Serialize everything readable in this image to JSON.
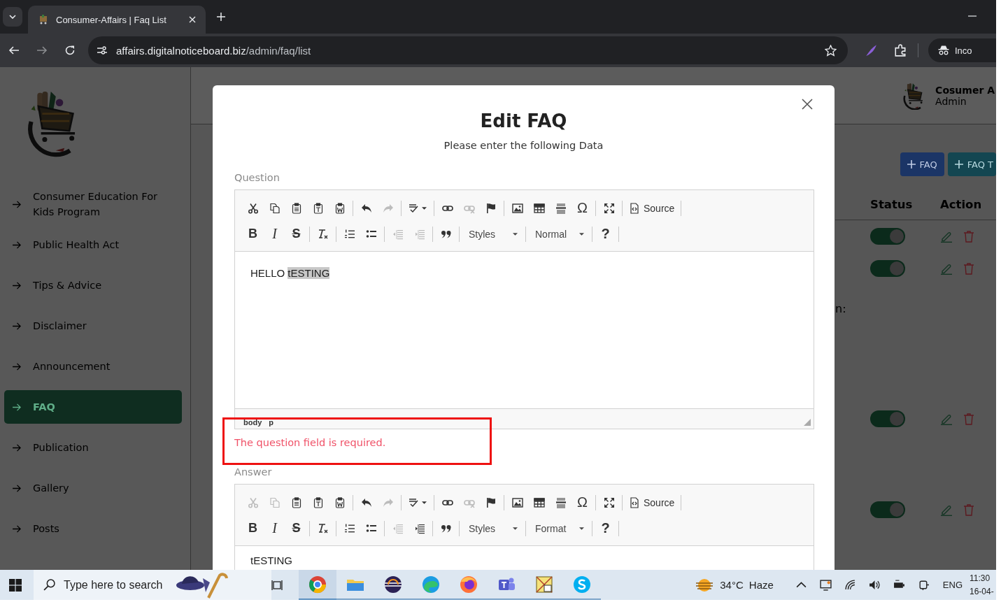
{
  "browser": {
    "tab": {
      "title": "Consumer-Affairs | Faq List"
    },
    "url": {
      "host": "affairs.digitalnoticeboard.biz",
      "path": "/admin/faq/list"
    },
    "profile": "Inco"
  },
  "sidebar": {
    "items": [
      {
        "label": "Consumer Education For Kids Program",
        "selected": false
      },
      {
        "label": "Public Health Act",
        "selected": false
      },
      {
        "label": "Tips & Advice",
        "selected": false
      },
      {
        "label": "Disclaimer",
        "selected": false
      },
      {
        "label": "Announcement",
        "selected": false
      },
      {
        "label": "FAQ",
        "selected": true
      },
      {
        "label": "Publication",
        "selected": false
      },
      {
        "label": "Gallery",
        "selected": false
      },
      {
        "label": "Posts",
        "selected": false
      }
    ]
  },
  "header": {
    "user_name": "Cosumer A",
    "user_role": "Admin"
  },
  "actions": [
    {
      "label": "FAQ",
      "color": "#1b3566"
    },
    {
      "label": "FAQ T",
      "color": "#134651"
    }
  ],
  "table": {
    "columns": [
      "Status",
      "Action"
    ],
    "rows": [
      {
        "on": true
      },
      {
        "column_1": "n:",
        "on": true
      },
      {
        "on": true
      },
      {
        "on": true
      }
    ]
  },
  "modal": {
    "title": "Edit FAQ",
    "subtitle": "Please enter the following Data",
    "question": {
      "label": "Question",
      "toolbar": [
        [
          [
            {
              "kind": "cut",
              "disabled": false
            },
            {
              "kind": "copy",
              "disabled": false
            },
            {
              "kind": "paste",
              "disabled": false
            },
            {
              "kind": "pastetext",
              "disabled": false
            },
            {
              "kind": "pasteword",
              "disabled": false
            }
          ],
          [
            {
              "kind": "undo",
              "disabled": false
            },
            {
              "kind": "redo",
              "disabled": true
            }
          ],
          [
            {
              "kind": "spellcheck",
              "disabled": false
            }
          ],
          [
            {
              "kind": "link",
              "disabled": false
            },
            {
              "kind": "unlink",
              "disabled": true
            },
            {
              "kind": "anchor",
              "disabled": false
            }
          ],
          [
            {
              "kind": "image",
              "disabled": false
            },
            {
              "kind": "table",
              "disabled": false
            },
            {
              "kind": "rule",
              "disabled": false
            },
            {
              "kind": "symbol",
              "text": "Ω",
              "disabled": false
            }
          ],
          [
            {
              "kind": "maximize",
              "disabled": false
            }
          ],
          [
            {
              "kind": "source",
              "text": "Source",
              "disabled": false
            }
          ]
        ],
        [
          [
            {
              "kind": "bold",
              "text": "B",
              "disabled": false
            },
            {
              "kind": "italic",
              "text": "I",
              "disabled": false
            },
            {
              "kind": "strike",
              "text": "S",
              "disabled": false
            }
          ],
          [
            {
              "kind": "clearformat",
              "disabled": false
            }
          ],
          [
            {
              "kind": "numbered",
              "disabled": false
            },
            {
              "kind": "bulleted",
              "disabled": false
            }
          ],
          [
            {
              "kind": "outdent",
              "disabled": true
            },
            {
              "kind": "indent",
              "disabled": true
            }
          ],
          [
            {
              "kind": "quote",
              "disabled": false
            }
          ],
          [
            {
              "kind": "combo",
              "text": "Styles",
              "disabled": false
            }
          ],
          [
            {
              "kind": "combo",
              "text": "Normal",
              "disabled": false
            }
          ],
          [
            {
              "kind": "help",
              "text": "?",
              "disabled": false
            }
          ]
        ]
      ],
      "content": [
        {
          "text": "HELLO ",
          "selected": false
        },
        {
          "text": "tESTING",
          "selected": true
        }
      ],
      "path": [
        "body",
        "p"
      ],
      "error": "The question field is required."
    },
    "answer": {
      "label": "Answer",
      "toolbar": [
        [
          [
            {
              "kind": "cut",
              "disabled": true
            },
            {
              "kind": "copy",
              "disabled": true
            },
            {
              "kind": "paste",
              "disabled": false
            },
            {
              "kind": "pastetext",
              "disabled": false
            },
            {
              "kind": "pasteword",
              "disabled": false
            }
          ],
          [
            {
              "kind": "undo",
              "disabled": false
            },
            {
              "kind": "redo",
              "disabled": true
            }
          ],
          [
            {
              "kind": "spellcheck",
              "disabled": false
            }
          ],
          [
            {
              "kind": "link",
              "disabled": false
            },
            {
              "kind": "unlink",
              "disabled": true
            },
            {
              "kind": "anchor",
              "disabled": false
            }
          ],
          [
            {
              "kind": "image",
              "disabled": false
            },
            {
              "kind": "table",
              "disabled": false
            },
            {
              "kind": "rule",
              "disabled": false
            },
            {
              "kind": "symbol",
              "text": "Ω",
              "disabled": false
            }
          ],
          [
            {
              "kind": "maximize",
              "disabled": false
            }
          ],
          [
            {
              "kind": "source",
              "text": "Source",
              "disabled": false
            }
          ]
        ],
        [
          [
            {
              "kind": "bold",
              "text": "B",
              "disabled": false
            },
            {
              "kind": "italic",
              "text": "I",
              "disabled": false
            },
            {
              "kind": "strike",
              "text": "S",
              "disabled": false
            }
          ],
          [
            {
              "kind": "clearformat",
              "disabled": false
            }
          ],
          [
            {
              "kind": "numbered",
              "disabled": false
            },
            {
              "kind": "bulleted",
              "disabled": false
            }
          ],
          [
            {
              "kind": "outdent",
              "disabled": true
            },
            {
              "kind": "indent",
              "disabled": false
            }
          ],
          [
            {
              "kind": "quote",
              "disabled": false
            }
          ],
          [
            {
              "kind": "combo",
              "text": "Styles",
              "disabled": false
            }
          ],
          [
            {
              "kind": "combo",
              "text": "Format",
              "disabled": false
            }
          ],
          [
            {
              "kind": "help",
              "text": "?",
              "disabled": false
            }
          ]
        ]
      ],
      "content": [
        {
          "text": "tESTING",
          "selected": false
        }
      ]
    }
  },
  "taskbar": {
    "search_placeholder": "Type here to search",
    "apps": [
      {
        "kind": "chrome",
        "selected": true
      },
      {
        "kind": "folder",
        "selected": false
      },
      {
        "kind": "eclipse",
        "selected": false
      },
      {
        "kind": "edge",
        "selected": false
      },
      {
        "kind": "firefox",
        "selected": false
      },
      {
        "kind": "teams",
        "selected": false
      },
      {
        "kind": "mail",
        "selected": false
      },
      {
        "kind": "skype",
        "selected": false
      }
    ],
    "temperature": "34°C",
    "condition": "Haze",
    "language": "ENG",
    "time": "11:30",
    "date": "16-04-"
  }
}
